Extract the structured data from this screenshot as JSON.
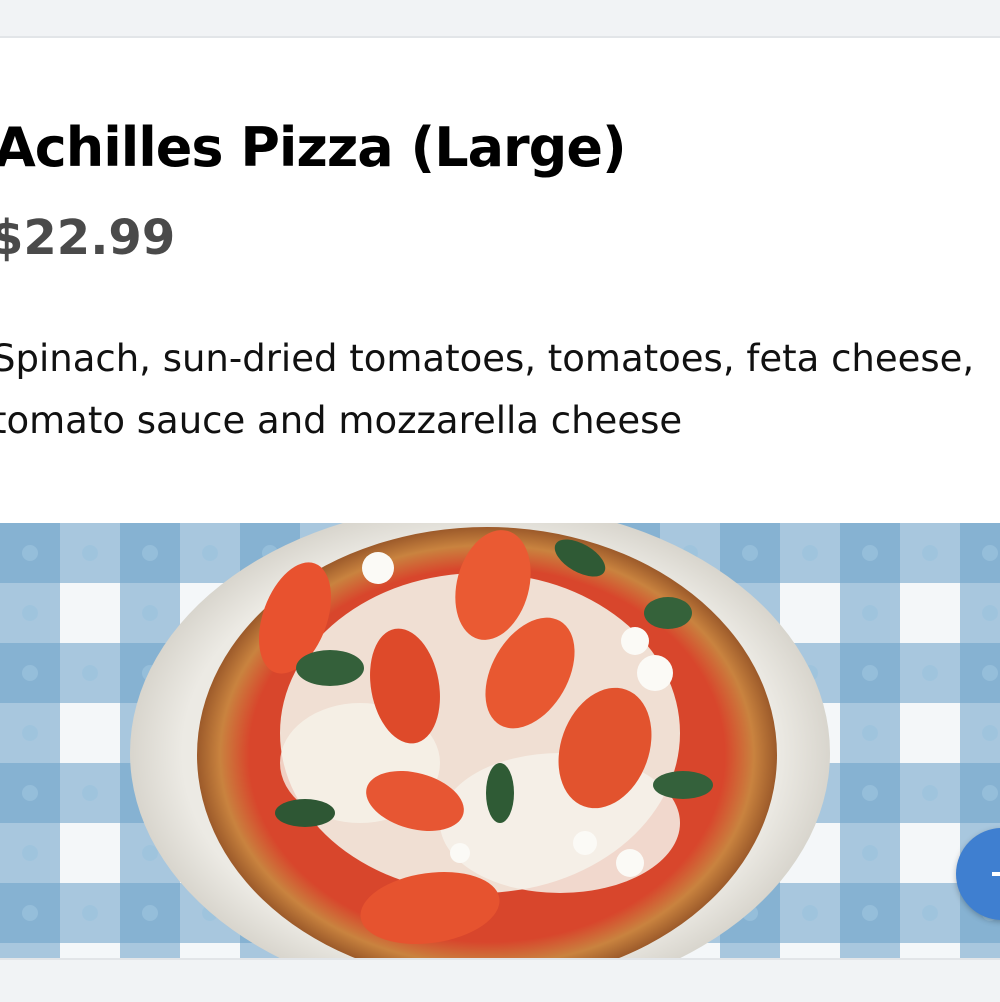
{
  "item": {
    "name": "Achilles Pizza (Large)",
    "price": "$22.99",
    "description": "Spinach, sun-dried tomatoes, tomatoes, feta cheese, tomato sauce and mozzarella cheese"
  },
  "image": {
    "subject": "pizza-photo",
    "icon": "pizza-icon"
  },
  "actions": {
    "add_icon": "plus-icon",
    "accent_color": "#3f7fd0"
  }
}
